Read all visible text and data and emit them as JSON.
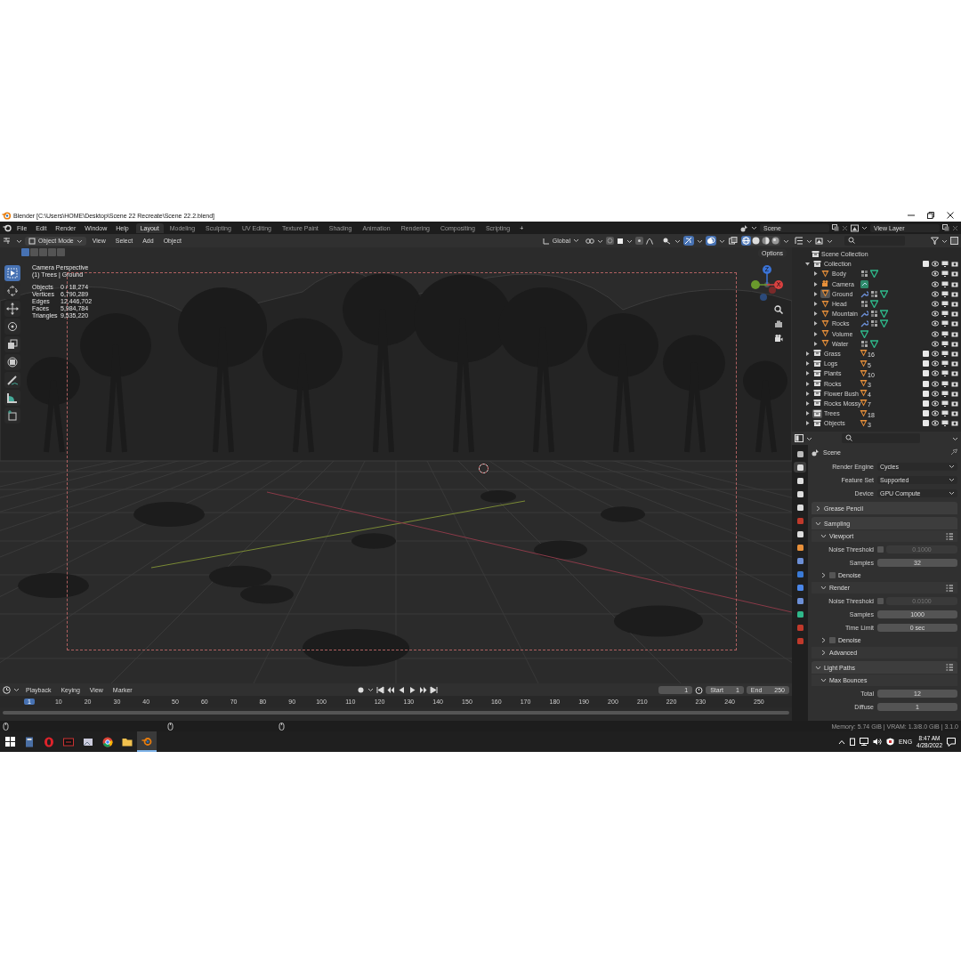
{
  "window": {
    "title": "Blender [C:\\Users\\HOME\\Desktop\\Scene 22 Recreate\\Scene 22.2.blend]"
  },
  "menus": [
    "File",
    "Edit",
    "Render",
    "Window",
    "Help"
  ],
  "workspaces": [
    {
      "label": "Layout",
      "selected": true
    },
    {
      "label": "Modeling",
      "selected": false
    },
    {
      "label": "Sculpting",
      "selected": false
    },
    {
      "label": "UV Editing",
      "selected": false
    },
    {
      "label": "Texture Paint",
      "selected": false
    },
    {
      "label": "Shading",
      "selected": false
    },
    {
      "label": "Animation",
      "selected": false
    },
    {
      "label": "Rendering",
      "selected": false
    },
    {
      "label": "Compositing",
      "selected": false
    },
    {
      "label": "Scripting",
      "selected": false
    }
  ],
  "add_workspace": "+",
  "scene": "Scene",
  "view_layer": "View Layer",
  "viewport": {
    "mode": "Object Mode",
    "menus": [
      "View",
      "Select",
      "Add",
      "Object"
    ],
    "orientation": "Global",
    "options": "Options",
    "toggles": [
      {
        "kind": "visibility",
        "on": false
      },
      {
        "kind": "gizmo",
        "on": true
      },
      {
        "kind": "overlay",
        "on": true
      },
      {
        "kind": "xray",
        "on": false
      }
    ],
    "shading": [
      {
        "kind": "wireframe",
        "selected": true
      },
      {
        "kind": "solid",
        "selected": false
      },
      {
        "kind": "material",
        "selected": false
      },
      {
        "kind": "rendered",
        "selected": false
      }
    ],
    "select_modes": [
      {
        "selected": true
      },
      {
        "selected": false
      },
      {
        "selected": false
      },
      {
        "selected": false
      },
      {
        "selected": false
      }
    ],
    "tools": [
      {
        "kind": "select",
        "selected": true
      },
      {
        "kind": "cursor",
        "selected": false
      },
      {
        "kind": "move",
        "selected": false
      },
      {
        "kind": "rotate",
        "selected": false
      },
      {
        "kind": "scale",
        "selected": false
      },
      {
        "kind": "transform",
        "selected": false
      },
      {
        "kind": "annotate",
        "selected": false
      },
      {
        "kind": "measure",
        "selected": false
      },
      {
        "kind": "add",
        "selected": false
      }
    ],
    "view_name": "Camera Perspective",
    "context": "(1) Trees | Ground",
    "stats": [
      {
        "label": "Objects",
        "value": "0 / 18,274"
      },
      {
        "label": "Vertices",
        "value": "6,790,289"
      },
      {
        "label": "Edges",
        "value": "12,446,702"
      },
      {
        "label": "Faces",
        "value": "5,984,784"
      },
      {
        "label": "Triangles",
        "value": "9,535,220"
      }
    ],
    "gizmo": [
      {
        "kind": "up",
        "label": "Z",
        "color": "#3b73d6"
      },
      {
        "kind": "right",
        "label": "X",
        "color": "#d8403f"
      },
      {
        "kind": "left",
        "color": "#6a9a2c"
      }
    ]
  },
  "timeline": {
    "menus": [
      "Playback",
      "Keying",
      "View",
      "Marker"
    ],
    "current_frame": "1",
    "start_label": "Start",
    "start": "1",
    "end_label": "End",
    "end": "250",
    "ticks": [
      {
        "label": "1",
        "current": true
      },
      {
        "label": "10",
        "current": false
      },
      {
        "label": "20",
        "current": false
      },
      {
        "label": "30",
        "current": false
      },
      {
        "label": "40",
        "current": false
      },
      {
        "label": "50",
        "current": false
      },
      {
        "label": "60",
        "current": false
      },
      {
        "label": "70",
        "current": false
      },
      {
        "label": "80",
        "current": false
      },
      {
        "label": "90",
        "current": false
      },
      {
        "label": "100",
        "current": false
      },
      {
        "label": "110",
        "current": false
      },
      {
        "label": "120",
        "current": false
      },
      {
        "label": "130",
        "current": false
      },
      {
        "label": "140",
        "current": false
      },
      {
        "label": "150",
        "current": false
      },
      {
        "label": "160",
        "current": false
      },
      {
        "label": "170",
        "current": false
      },
      {
        "label": "180",
        "current": false
      },
      {
        "label": "190",
        "current": false
      },
      {
        "label": "200",
        "current": false
      },
      {
        "label": "210",
        "current": false
      },
      {
        "label": "220",
        "current": false
      },
      {
        "label": "230",
        "current": false
      },
      {
        "label": "240",
        "current": false
      },
      {
        "label": "250",
        "current": false
      }
    ]
  },
  "outliner": {
    "root": "Scene Collection",
    "items": [
      {
        "name": "Collection",
        "kind": "collection",
        "expanded": true,
        "checked": true,
        "active": false,
        "children": [
          {
            "name": "Body",
            "kind": "mesh",
            "active": false,
            "data_icons": [
              {
                "kind": "groups"
              },
              {
                "kind": "mesh"
              }
            ]
          },
          {
            "name": "Camera",
            "kind": "camera",
            "active": false,
            "data_icons": [
              {
                "kind": "camera_data"
              }
            ]
          },
          {
            "name": "Ground",
            "kind": "mesh",
            "active": true,
            "data_icons": [
              {
                "kind": "modifier"
              },
              {
                "kind": "groups"
              },
              {
                "kind": "mesh"
              }
            ]
          },
          {
            "name": "Head",
            "kind": "mesh",
            "active": false,
            "data_icons": [
              {
                "kind": "groups"
              },
              {
                "kind": "mesh"
              }
            ]
          },
          {
            "name": "Mountain",
            "kind": "mesh",
            "active": false,
            "data_icons": [
              {
                "kind": "modifier"
              },
              {
                "kind": "groups"
              },
              {
                "kind": "mesh"
              }
            ]
          },
          {
            "name": "Rocks",
            "kind": "mesh",
            "active": false,
            "data_icons": [
              {
                "kind": "modifier"
              },
              {
                "kind": "groups"
              },
              {
                "kind": "mesh"
              }
            ]
          },
          {
            "name": "Volume",
            "kind": "mesh",
            "active": false,
            "data_icons": [
              {
                "kind": "mesh"
              }
            ]
          },
          {
            "name": "Water",
            "kind": "mesh",
            "active": false,
            "data_icons": [
              {
                "kind": "groups"
              },
              {
                "kind": "mesh"
              }
            ]
          }
        ]
      },
      {
        "name": "Grass",
        "kind": "collection",
        "expanded": false,
        "checked": true,
        "active": false,
        "count": "16"
      },
      {
        "name": "Logs",
        "kind": "collection",
        "expanded": false,
        "checked": true,
        "active": false,
        "count": "5"
      },
      {
        "name": "Plants",
        "kind": "collection",
        "expanded": false,
        "checked": true,
        "active": false,
        "count": "10"
      },
      {
        "name": "Rocks",
        "kind": "collection",
        "expanded": false,
        "checked": true,
        "active": false,
        "count": "3"
      },
      {
        "name": "Flower Bush",
        "kind": "collection",
        "expanded": false,
        "checked": true,
        "active": false,
        "count": "4"
      },
      {
        "name": "Rocks Mossy",
        "kind": "collection",
        "expanded": false,
        "checked": true,
        "active": false,
        "count": "7"
      },
      {
        "name": "Trees",
        "kind": "collection",
        "expanded": false,
        "checked": true,
        "active": true,
        "count": "18"
      },
      {
        "name": "Objects",
        "kind": "collection",
        "expanded": false,
        "checked": true,
        "active": false,
        "count": "3"
      }
    ]
  },
  "properties": {
    "tabs": [
      {
        "kind": "tool",
        "selected": false
      },
      {
        "kind": "render",
        "selected": true
      },
      {
        "kind": "output",
        "selected": false
      },
      {
        "kind": "view_layer",
        "selected": false
      },
      {
        "kind": "scene",
        "selected": false
      },
      {
        "kind": "world",
        "selected": false
      },
      {
        "kind": "collection",
        "selected": false
      },
      {
        "kind": "object",
        "selected": false
      },
      {
        "kind": "modifier",
        "selected": false
      },
      {
        "kind": "particles",
        "selected": false
      },
      {
        "kind": "physics",
        "selected": false
      },
      {
        "kind": "constraints",
        "selected": false
      },
      {
        "kind": "data",
        "selected": false
      },
      {
        "kind": "material",
        "selected": false
      },
      {
        "kind": "texture",
        "selected": false
      }
    ],
    "header": "Scene",
    "fields": [
      {
        "label": "Render Engine",
        "value": "Cycles"
      },
      {
        "label": "Feature Set",
        "value": "Supported"
      },
      {
        "label": "Device",
        "value": "GPU Compute"
      }
    ],
    "rows": [
      {
        "kind": "panel",
        "label": "Grease Pencil",
        "expanded": false
      },
      {
        "kind": "panel",
        "label": "Sampling",
        "expanded": true
      },
      {
        "kind": "subpanel",
        "label": "Viewport",
        "expanded": true,
        "presets": true
      },
      {
        "kind": "toggle_field",
        "label": "Noise Threshold",
        "checked": false,
        "value": "0.1000"
      },
      {
        "kind": "field",
        "label": "Samples",
        "value": "32"
      },
      {
        "kind": "check_subpanel",
        "label": "Denoise",
        "expanded": false,
        "checked": false
      },
      {
        "kind": "subpanel",
        "label": "Render",
        "expanded": true,
        "presets": true
      },
      {
        "kind": "toggle_field",
        "label": "Noise Threshold",
        "checked": false,
        "value": "0.0100"
      },
      {
        "kind": "field",
        "label": "Samples",
        "value": "1000"
      },
      {
        "kind": "field",
        "label": "Time Limit",
        "value": "0 sec"
      },
      {
        "kind": "check_subpanel",
        "label": "Denoise",
        "expanded": false,
        "checked": false
      },
      {
        "kind": "subpanel",
        "label": "Advanced",
        "expanded": false
      },
      {
        "kind": "panel",
        "label": "Light Paths",
        "expanded": true,
        "presets": true
      },
      {
        "kind": "subpanel",
        "label": "Max Bounces",
        "expanded": true
      },
      {
        "kind": "field",
        "label": "Total",
        "value": "12"
      },
      {
        "kind": "field",
        "label": "Diffuse",
        "value": "1"
      }
    ]
  },
  "status": "Memory: 5.74 GiB | VRAM: 1.3/8.0 GiB | 3.1.0",
  "taskbar": {
    "apps": [
      {
        "kind": "calculator",
        "active": false
      },
      {
        "kind": "opera",
        "active": false
      },
      {
        "kind": "ryzen",
        "active": false
      },
      {
        "kind": "photos",
        "active": false
      },
      {
        "kind": "chrome",
        "active": false
      },
      {
        "kind": "folder",
        "active": false
      },
      {
        "kind": "blender",
        "active": true
      }
    ],
    "language": "ENG",
    "time": "8:47 AM",
    "date": "4/28/2022"
  }
}
